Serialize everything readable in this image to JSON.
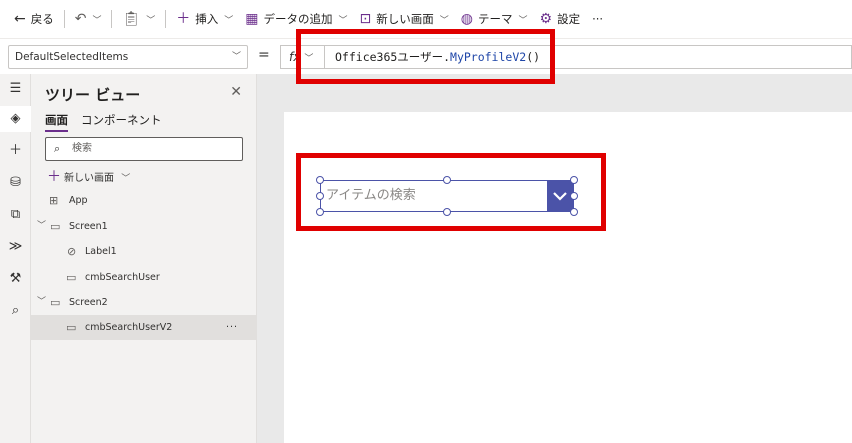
{
  "command_bar": {
    "back": "戻る",
    "insert": "挿入",
    "add_data": "データの追加",
    "new_screen": "新しい画面",
    "theme": "テーマ",
    "settings": "設定",
    "more": "···"
  },
  "formula_bar": {
    "property": "DefaultSelectedItems",
    "equals": "=",
    "fx": "fx",
    "formula_object": "Office365ユーザー.",
    "formula_function": "MyProfileV2",
    "formula_tail": "()"
  },
  "tree": {
    "title": "ツリー ビュー",
    "tab_screens": "画面",
    "tab_components": "コンポーネント",
    "search_placeholder": "検索",
    "new_screen": "新しい画面",
    "nodes": [
      {
        "label": "App"
      },
      {
        "label": "Screen1"
      },
      {
        "label": "Label1"
      },
      {
        "label": "cmbSearchUser"
      },
      {
        "label": "Screen2"
      },
      {
        "label": "cmbSearchUserV2"
      }
    ],
    "more": "···"
  },
  "canvas": {
    "combo_placeholder": "アイテムの検索"
  },
  "colors": {
    "accent": "#6b2f8c",
    "combo": "#4b53a8",
    "highlight": "#e00000"
  }
}
